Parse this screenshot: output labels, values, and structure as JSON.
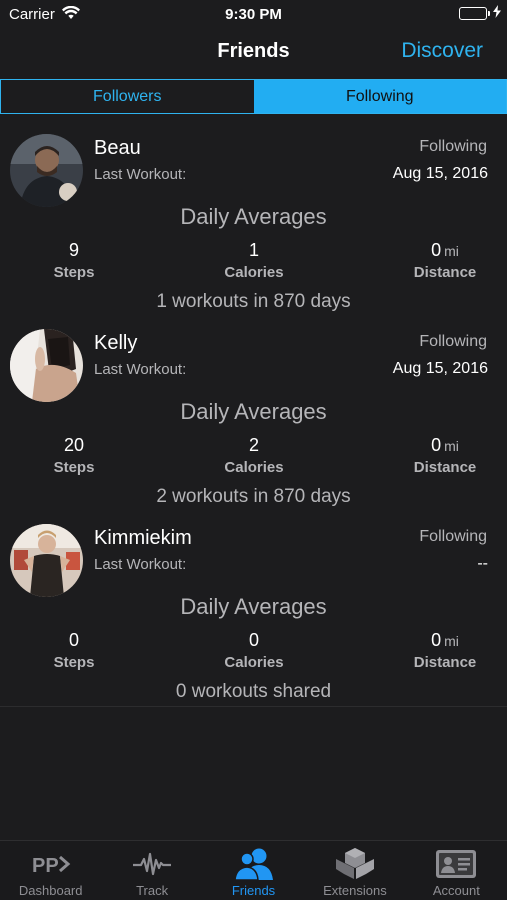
{
  "status_bar": {
    "carrier": "Carrier",
    "time": "9:30 PM"
  },
  "nav": {
    "title": "Friends",
    "discover": "Discover"
  },
  "segments": {
    "followers": "Followers",
    "following": "Following",
    "selected": "Following"
  },
  "colors": {
    "accent": "#2fb3ef",
    "segment_active": "#22adf2",
    "tab_active": "#2196f3",
    "background": "#1c1c1e"
  },
  "friends": [
    {
      "name": "Beau",
      "status": "Following",
      "last_workout_label": "Last Workout:",
      "last_workout": "Aug 15, 2016",
      "averages_title": "Daily Averages",
      "steps": "9",
      "steps_label": "Steps",
      "calories": "1",
      "calories_label": "Calories",
      "distance": "0",
      "distance_unit": "mi",
      "distance_label": "Distance",
      "workouts": "1 workouts in 870 days"
    },
    {
      "name": "Kelly",
      "status": "Following",
      "last_workout_label": "Last Workout:",
      "last_workout": "Aug 15, 2016",
      "averages_title": "Daily Averages",
      "steps": "20",
      "steps_label": "Steps",
      "calories": "2",
      "calories_label": "Calories",
      "distance": "0",
      "distance_unit": "mi",
      "distance_label": "Distance",
      "workouts": "2 workouts in 870 days"
    },
    {
      "name": "Kimmiekim",
      "status": "Following",
      "last_workout_label": "Last Workout:",
      "last_workout": "--",
      "averages_title": "Daily Averages",
      "steps": "0",
      "steps_label": "Steps",
      "calories": "0",
      "calories_label": "Calories",
      "distance": "0",
      "distance_unit": "mi",
      "distance_label": "Distance",
      "workouts": "0 workouts shared"
    }
  ],
  "tabs": [
    {
      "label": "Dashboard",
      "icon": "dashboard-icon"
    },
    {
      "label": "Track",
      "icon": "pulse-icon"
    },
    {
      "label": "Friends",
      "icon": "people-icon",
      "active": true
    },
    {
      "label": "Extensions",
      "icon": "cubes-icon"
    },
    {
      "label": "Account",
      "icon": "id-card-icon"
    }
  ]
}
